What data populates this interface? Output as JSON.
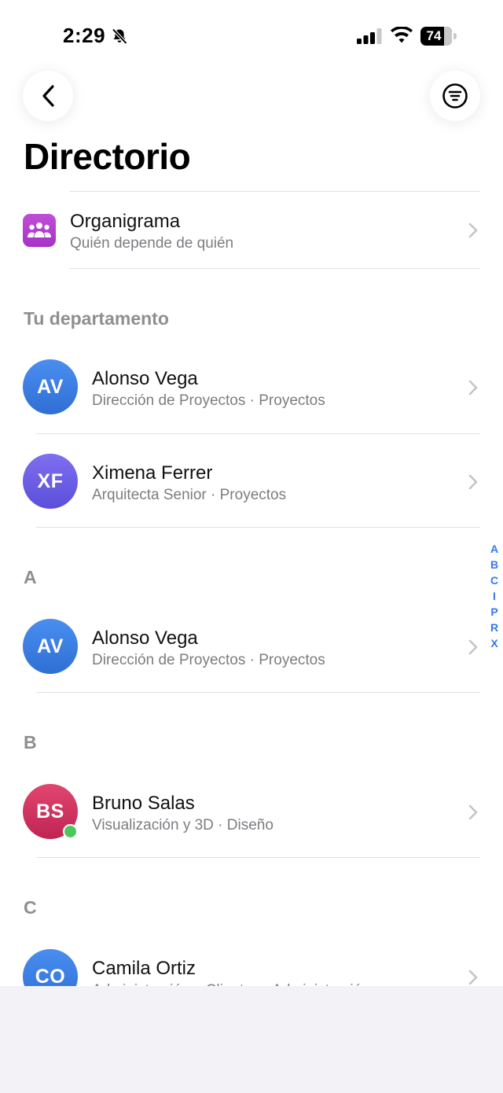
{
  "status_bar": {
    "time": "2:29",
    "battery": "74"
  },
  "header": {
    "title": "Directorio"
  },
  "org_chart": {
    "title": "Organigrama",
    "subtitle": "Quién depende de quién"
  },
  "my_department": {
    "header": "Tu departamento",
    "contacts": [
      {
        "initials": "AV",
        "name": "Alonso Vega",
        "subtitle": "Dirección de Proyectos · Proyectos",
        "color": "#3b7fde"
      },
      {
        "initials": "XF",
        "name": "Ximena Ferrer",
        "subtitle": "Arquitecta Senior · Proyectos",
        "color": "#6d5ee8"
      }
    ]
  },
  "sections": [
    {
      "letter": "A",
      "contacts": [
        {
          "initials": "AV",
          "name": "Alonso Vega",
          "subtitle": "Dirección de Proyectos · Proyectos",
          "color": "#3b7fde",
          "online": false
        }
      ]
    },
    {
      "letter": "B",
      "contacts": [
        {
          "initials": "BS",
          "name": "Bruno Salas",
          "subtitle": "Visualización y 3D · Diseño",
          "color": "#d2325e",
          "online": true
        }
      ]
    },
    {
      "letter": "C",
      "contacts": [
        {
          "initials": "CO",
          "name": "Camila Ortiz",
          "subtitle": "Administración y Clientes · Administración",
          "color": "#3b7fde",
          "online": false
        }
      ]
    }
  ],
  "index_letters": [
    "A",
    "B",
    "C",
    "I",
    "P",
    "R",
    "X"
  ],
  "colors": {
    "accent": "#3478f6",
    "online": "#4cc75a",
    "org_icon": "#b23fce"
  }
}
